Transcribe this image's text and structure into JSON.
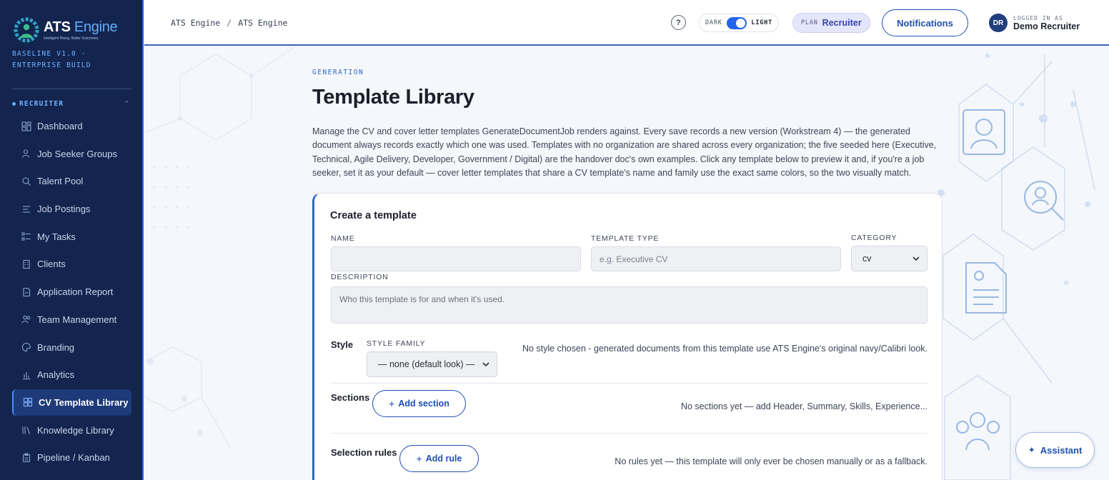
{
  "brand": {
    "name_main": "ATS",
    "name_accent": "Engine",
    "tagline": "Intelligent Hiring. Better Outcomes.",
    "build": "BASELINE V1.0 · ENTERPRISE BUILD",
    "accent_color": "#2563eb",
    "sidebar_color": "#13244f"
  },
  "sidebar": {
    "role_label": "RECRUITER",
    "items": [
      {
        "label": "Dashboard",
        "icon": "dashboard-icon"
      },
      {
        "label": "Job Seeker Groups",
        "icon": "people-icon"
      },
      {
        "label": "Talent Pool",
        "icon": "search-icon"
      },
      {
        "label": "Job Postings",
        "icon": "list-icon"
      },
      {
        "label": "My Tasks",
        "icon": "tasks-icon"
      },
      {
        "label": "Clients",
        "icon": "building-icon"
      },
      {
        "label": "Application Report",
        "icon": "report-icon"
      },
      {
        "label": "Team Management",
        "icon": "team-icon"
      },
      {
        "label": "Branding",
        "icon": "palette-icon"
      },
      {
        "label": "Analytics",
        "icon": "chart-icon"
      },
      {
        "label": "CV Template Library",
        "icon": "template-icon",
        "active": true
      },
      {
        "label": "Knowledge Library",
        "icon": "library-icon"
      },
      {
        "label": "Pipeline / Kanban",
        "icon": "clipboard-icon"
      }
    ]
  },
  "header": {
    "breadcrumb": [
      "ATS Engine",
      "ATS Engine"
    ],
    "help": "?",
    "theme": {
      "dark": "DARK",
      "light": "LIGHT"
    },
    "plan": {
      "key": "PLAN",
      "value": "Recruiter"
    },
    "notifications": "Notifications",
    "user": {
      "initials": "DR",
      "key": "LOGGED IN AS",
      "name": "Demo Recruiter"
    }
  },
  "main": {
    "eyebrow": "GENERATION",
    "title": "Template Library",
    "intro": "Manage the CV and cover letter templates GenerateDocumentJob renders against. Every save records a new version (Workstream 4) — the generated document always records exactly which one was used. Templates with no organization are shared across every organization; the five seeded here (Executive, Technical, Agile Delivery, Developer, Government / Digital) are the handover doc's own examples. Click any template below to preview it and, if you're a job seeker, set it as your default — cover letter templates that share a CV template's name and family use the exact same colors, so the two visually match."
  },
  "form": {
    "title": "Create a template",
    "name_label": "NAME",
    "name_value": "",
    "type_label": "TEMPLATE TYPE",
    "type_placeholder": "e.g. Executive CV",
    "category_label": "CATEGORY",
    "category_value": "cv",
    "description_label": "DESCRIPTION",
    "description_placeholder": "Who this template is for and when it's used.",
    "style_heading": "Style",
    "style_family_label": "STYLE FAMILY",
    "style_family_value": "— none (default look) —",
    "style_hint": "No style chosen - generated documents from this template use ATS Engine's original navy/Calibri look.",
    "sections_heading": "Sections",
    "add_section": "Add section",
    "sections_hint": "No sections yet — add Header, Summary, Skills, Experience...",
    "rules_heading": "Selection rules",
    "add_rule": "Add rule",
    "rules_hint": "No rules yet — this template will only ever be chosen manually or as a fallback."
  },
  "assistant": {
    "label": "Assistant",
    "icon": "sparkle-icon"
  }
}
